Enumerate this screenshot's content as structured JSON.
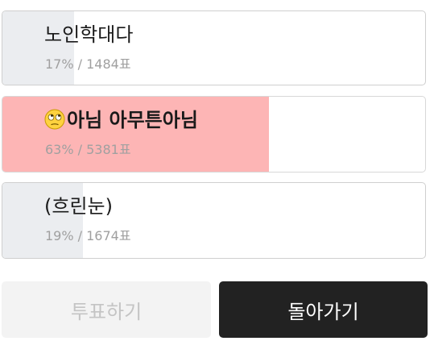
{
  "options": [
    {
      "label": "노인학대다",
      "stats": "17% / 1484표",
      "percent": 17,
      "selected": false
    },
    {
      "label": "아님 아무튼아님",
      "icon": "face-with-rolling-eyes-emoji",
      "stats": "63% / 5381표",
      "percent": 63,
      "selected": true
    },
    {
      "label": "(흐린눈)",
      "stats": "19% / 1674표",
      "percent": 19,
      "selected": false
    }
  ],
  "buttons": {
    "vote_label": "투표하기",
    "back_label": "돌아가기"
  },
  "colors": {
    "bar_default": "#ebedf0",
    "bar_selected": "#fdb5b5",
    "back_button_bg": "#222222",
    "vote_button_bg": "#f3f3f3"
  }
}
